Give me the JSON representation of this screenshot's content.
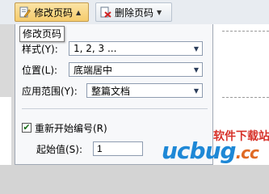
{
  "toolbar": {
    "modify_page_number": "修改页码",
    "delete_page_number": "删除页码"
  },
  "tooltip": "修改页码",
  "panel": {
    "style_label": "样式(Y):",
    "style_value": "1, 2, 3 ...",
    "position_label": "位置(L):",
    "position_value": "底端居中",
    "apply_label": "应用范围(Y):",
    "apply_value": "整篇文档",
    "restart_label": "重新开始编号(R)",
    "restart_checked": true,
    "start_label": "起始值(S):",
    "start_value": "1"
  },
  "watermark": {
    "top": "软件下载站",
    "main": "ucbug",
    "suffix": ".cc"
  },
  "colors": {
    "active_button": "#f5cb6c",
    "watermark_blue": "#1e88d6",
    "watermark_red": "#d7322a"
  }
}
